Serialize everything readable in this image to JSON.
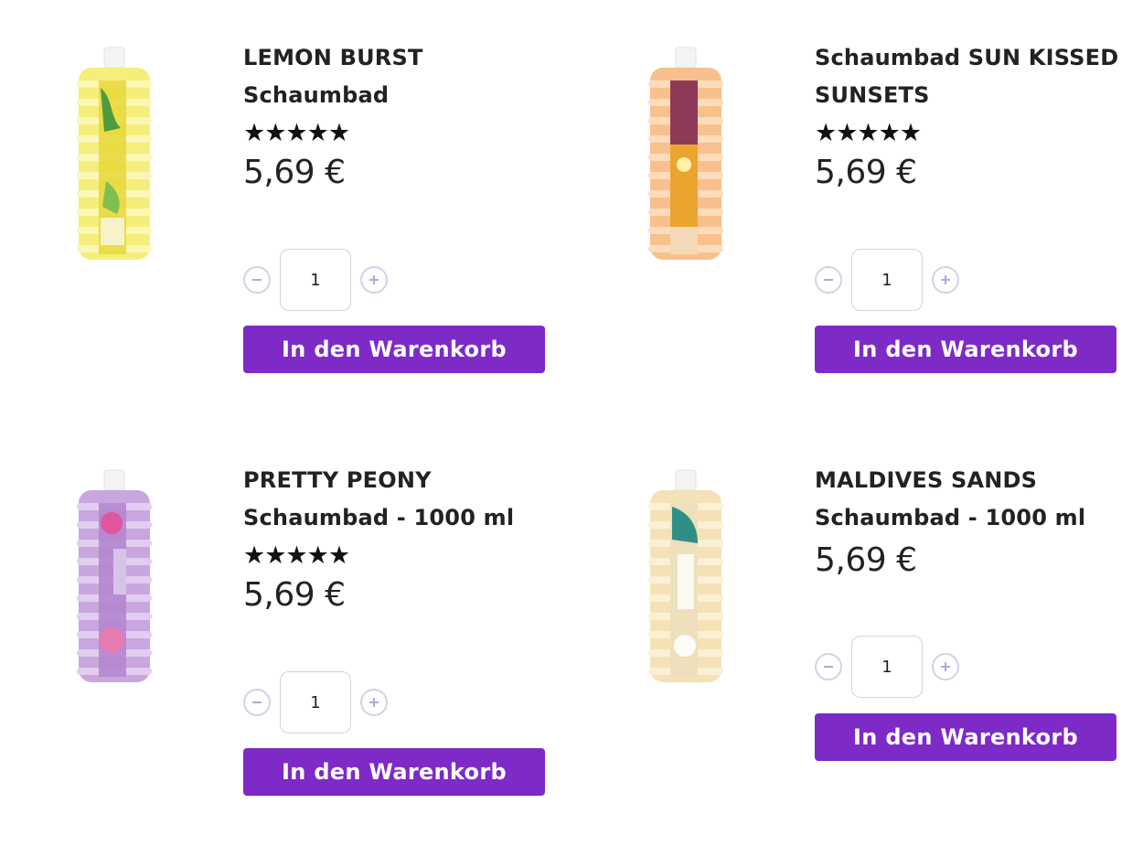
{
  "common": {
    "add_to_cart_label": "In den Warenkorb",
    "accent_color": "#7d2ac7"
  },
  "products": [
    {
      "name_line1": "LEMON BURST",
      "name_line2": "Schaumbad",
      "stars": "★★★★★",
      "rating_stars": 5,
      "price": "5,69 €",
      "quantity": "1",
      "image_icon": "bubble-bath-bottle-lemon"
    },
    {
      "name_line1": "Schaumbad SUN KISSED",
      "name_line2": "SUNSETS",
      "stars": "★★★★★",
      "rating_stars": 5,
      "price": "5,69 €",
      "quantity": "1",
      "image_icon": "bubble-bath-bottle-sunset"
    },
    {
      "name_line1": "PRETTY PEONY",
      "name_line2": "Schaumbad - 1000 ml",
      "stars": "★★★★★",
      "rating_stars": 5,
      "price": "5,69 €",
      "quantity": "1",
      "image_icon": "bubble-bath-bottle-peony"
    },
    {
      "name_line1": "MALDIVES SANDS",
      "name_line2": "Schaumbad - 1000 ml",
      "stars": "",
      "price": "5,69 €",
      "quantity": "1",
      "image_icon": "bubble-bath-bottle-maldives"
    }
  ]
}
